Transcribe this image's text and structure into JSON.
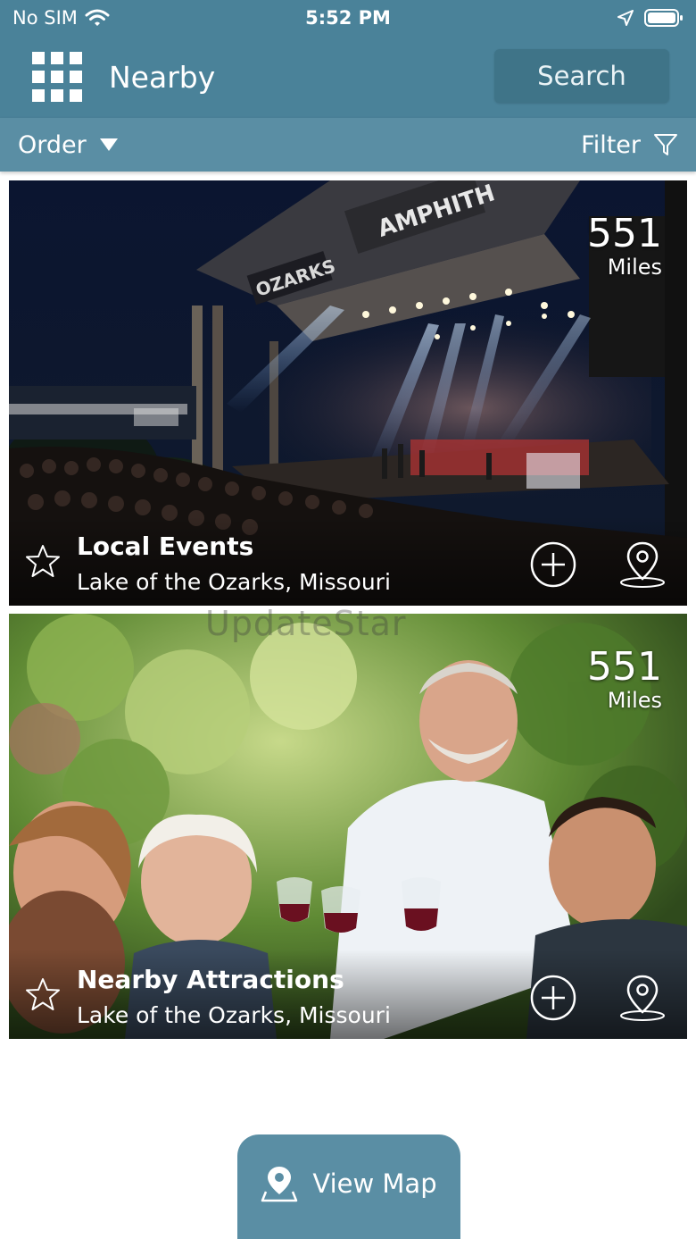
{
  "status_bar": {
    "carrier": "No SIM",
    "time": "5:52 PM"
  },
  "header": {
    "title": "Nearby",
    "search_label": "Search"
  },
  "toolbar": {
    "order_label": "Order",
    "filter_label": "Filter"
  },
  "cards": [
    {
      "title": "Local Events",
      "subtitle": "Lake of the Ozarks, Missouri",
      "distance": "551",
      "distance_unit": "Miles",
      "photo": "amphitheater-concert-photo",
      "stage_sign": "OZARKS",
      "stage_sign_2": "AMPHITH"
    },
    {
      "title": "Nearby Attractions",
      "subtitle": "Lake of the Ozarks, Missouri",
      "distance": "551",
      "distance_unit": "Miles",
      "photo": "friends-toasting-wine-photo"
    }
  ],
  "watermark": "UpdateStar",
  "view_map_label": "View Map",
  "colors": {
    "primary": "#4a8299",
    "toolbar": "#5a8ea4",
    "button_dark": "#3f7488"
  }
}
